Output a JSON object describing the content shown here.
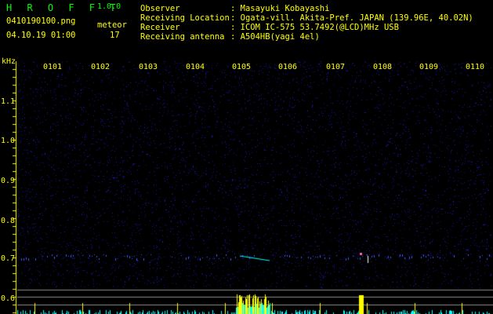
{
  "app": {
    "name": "H R O F F T",
    "version": "1.0.0"
  },
  "file": {
    "name": "0410190100.png",
    "datetime": "04.10.19 01:00"
  },
  "meteor": {
    "label": "meteor",
    "count": "17"
  },
  "info": [
    {
      "key": "Observer",
      "value": ": Masayuki Kobayashi"
    },
    {
      "key": "Receiving Location",
      "value": ": Ogata-vill. Akita-Pref. JAPAN (139.96E, 40.02N)"
    },
    {
      "key": "Receiver",
      "value": ": ICOM IC-575 53.7492(@LCD)MHz USB"
    },
    {
      "key": "Receiving antenna",
      "value": ": A504HB(yagi 4el)"
    }
  ],
  "spectrogram": {
    "freq_unit": "kHz",
    "time_ticks": [
      "0101",
      "0102",
      "0103",
      "0104",
      "0105",
      "0106",
      "0107",
      "0108",
      "0109",
      "0110"
    ],
    "freq_ticks": [
      "1.1",
      "1.0",
      "0.9",
      "0.8",
      "0.7",
      "0.6"
    ],
    "colors": {
      "background": "#000000",
      "noise": "#1c1c9a",
      "text": "#ffff00",
      "meteor": "#00ffff",
      "hist": "#00ffff",
      "hist_peak": "#ffff00"
    }
  }
}
